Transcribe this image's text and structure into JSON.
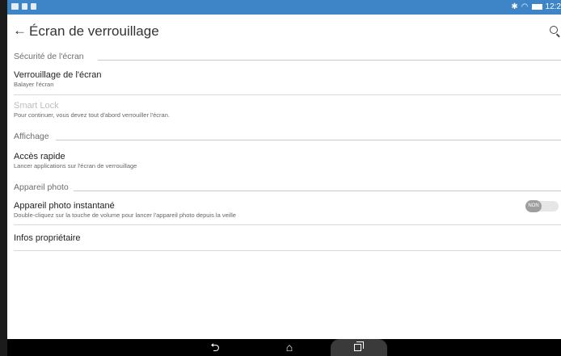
{
  "status_bar": {
    "time": "12:2",
    "icons": [
      "notification-icon",
      "screenshot-icon",
      "image-icon",
      "bluetooth-icon",
      "wifi-icon",
      "battery-icon"
    ]
  },
  "app_bar": {
    "title": "Écran de verrouillage",
    "back_icon": "←"
  },
  "sections": {
    "screen_security": {
      "header": "Sécurité de l'écran"
    },
    "display": {
      "header": "Affichage"
    },
    "camera": {
      "header": "Appareil photo"
    }
  },
  "items": {
    "screen_lock": {
      "title": "Verrouillage de l'écran",
      "subtitle": "Balayer l'écran"
    },
    "smart_lock": {
      "title": "Smart Lock",
      "subtitle": "Pour continuer, vous devez tout d'abord verrouiller l'écran."
    },
    "quick_access": {
      "title": "Accès rapide",
      "subtitle": "Lancer applications sur l'écran de verrouillage"
    },
    "instant_camera": {
      "title": "Appareil photo instantané",
      "subtitle": "Double-cliquez sur la touche de volume pour lancer l'appareil photo depuis la veille",
      "toggle_label": "NON"
    },
    "owner_info": {
      "title": "Infos propriétaire"
    }
  },
  "colors": {
    "status_bar": "#3d85c6",
    "nav_bar": "#000000",
    "disabled_text": "#bdbdbd"
  }
}
